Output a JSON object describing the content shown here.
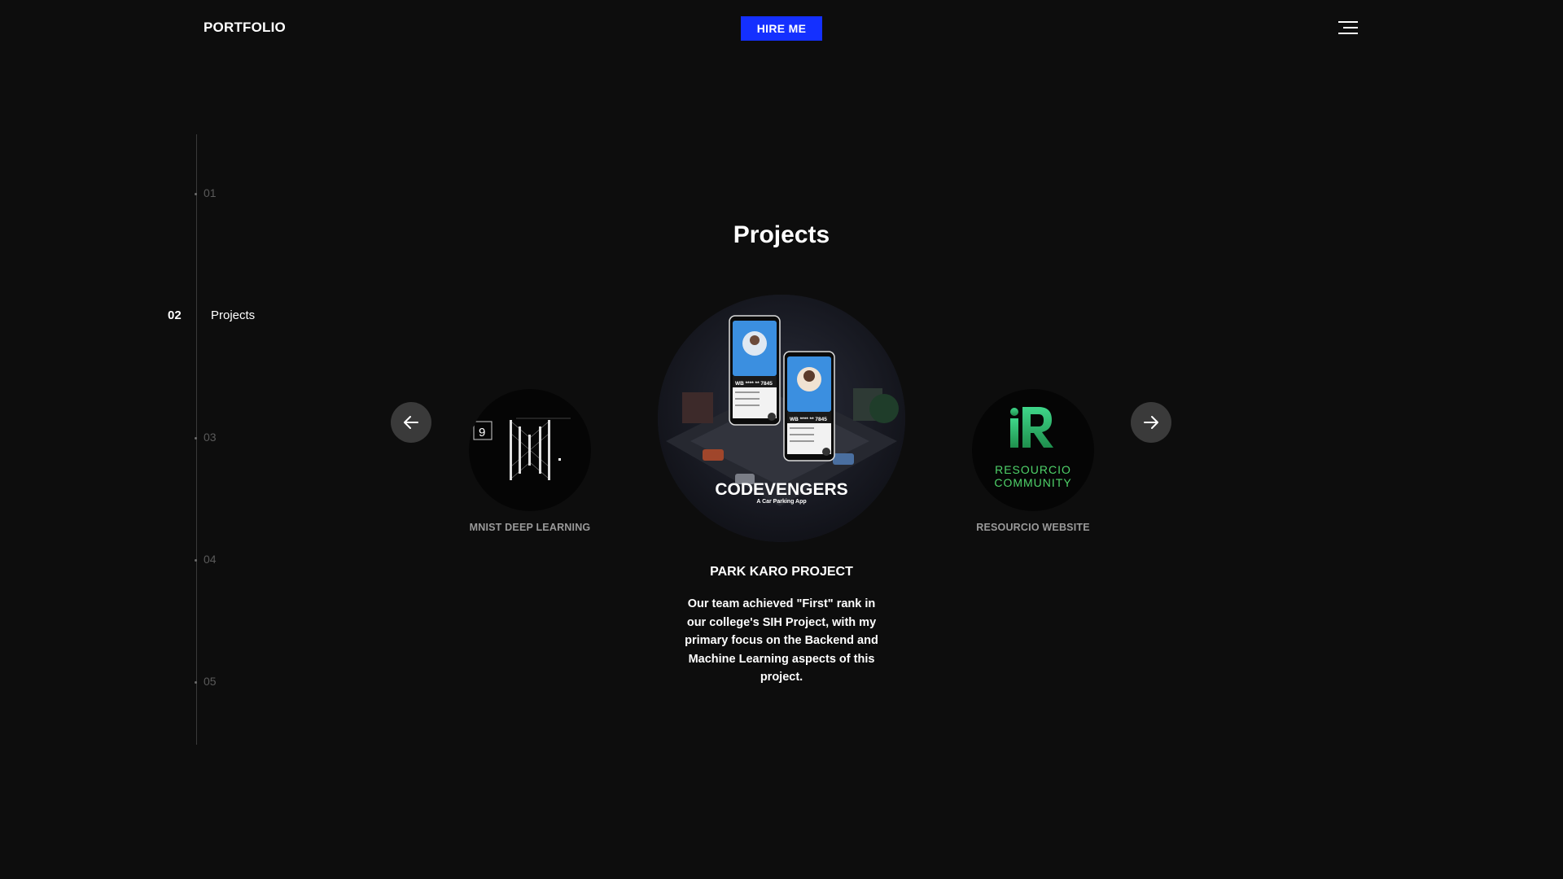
{
  "header": {
    "logo": "PORTFOLIO",
    "hire_label": "HIRE ME",
    "menu_icon": "hamburger-menu-icon"
  },
  "side_nav": {
    "items": [
      {
        "num": "01",
        "label": ""
      },
      {
        "num": "02",
        "label": "Projects",
        "active": true
      },
      {
        "num": "03",
        "label": ""
      },
      {
        "num": "04",
        "label": ""
      },
      {
        "num": "05",
        "label": ""
      }
    ]
  },
  "section": {
    "title": "Projects"
  },
  "carousel": {
    "prev_icon": "arrow-left-icon",
    "next_icon": "arrow-right-icon",
    "left_project": {
      "caption": "MNIST DEEP LEARNING",
      "thumb_digit": "9"
    },
    "center_project": {
      "title": "PARK KARO PROJECT",
      "image_brand": "CODEVENGERS",
      "image_tagline": "A Car Parking App",
      "phone_card_number": "WB **** ** 7845",
      "description": "Our team achieved \"First\" rank in our college's SIH Project, with my primary focus on the Backend and Machine Learning aspects of this project."
    },
    "right_project": {
      "caption": "RESOURCIO WEBSITE",
      "logo_line1": "RESOURCIO",
      "logo_line2": "COMMUNITY"
    }
  },
  "colors": {
    "background": "#0d0d0d",
    "accent": "#1430ff",
    "resourcio_green": "#4fd36a"
  }
}
